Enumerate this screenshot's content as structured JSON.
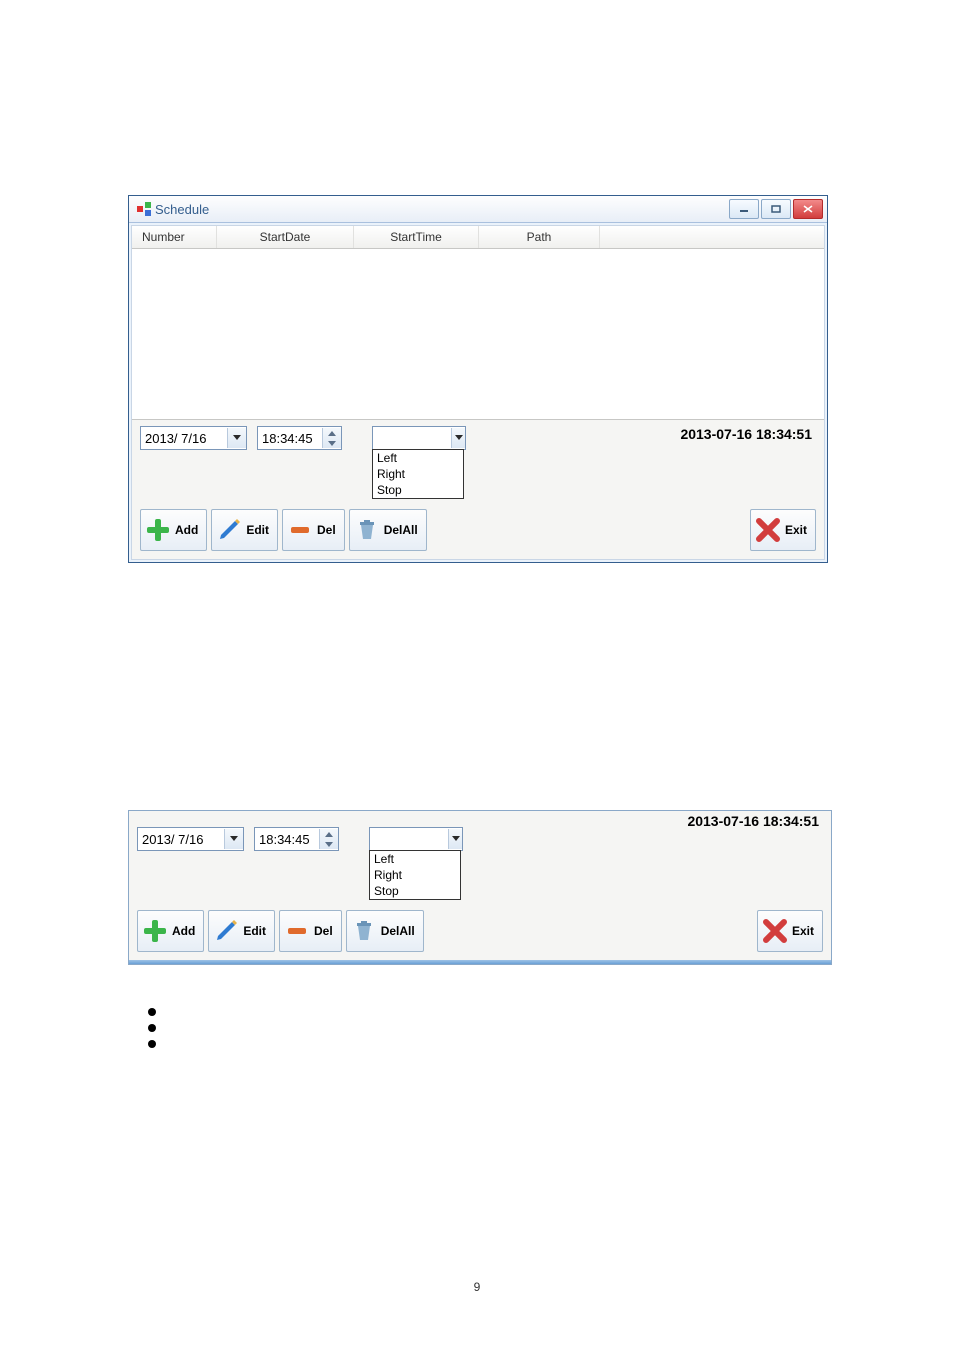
{
  "win1": {
    "title": "Schedule",
    "columns": {
      "c1": "Number",
      "c2": "StartDate",
      "c3": "StartTime",
      "c4": "Path"
    },
    "date": "2013/ 7/16",
    "time": "18:34:45",
    "combo_options": {
      "o1": "Left",
      "o2": "Right",
      "o3": "Stop"
    },
    "timestamp": "2013-07-16 18:34:51",
    "buttons": {
      "add": "Add",
      "edit": "Edit",
      "del": "Del",
      "delall": "DelAll",
      "exit": "Exit"
    }
  },
  "win2": {
    "date": "2013/ 7/16",
    "time": "18:34:45",
    "combo_options": {
      "o1": "Left",
      "o2": "Right",
      "o3": "Stop"
    },
    "timestamp": "2013-07-16 18:34:51",
    "buttons": {
      "add": "Add",
      "edit": "Edit",
      "del": "Del",
      "delall": "DelAll",
      "exit": "Exit"
    }
  },
  "page_number": "9"
}
